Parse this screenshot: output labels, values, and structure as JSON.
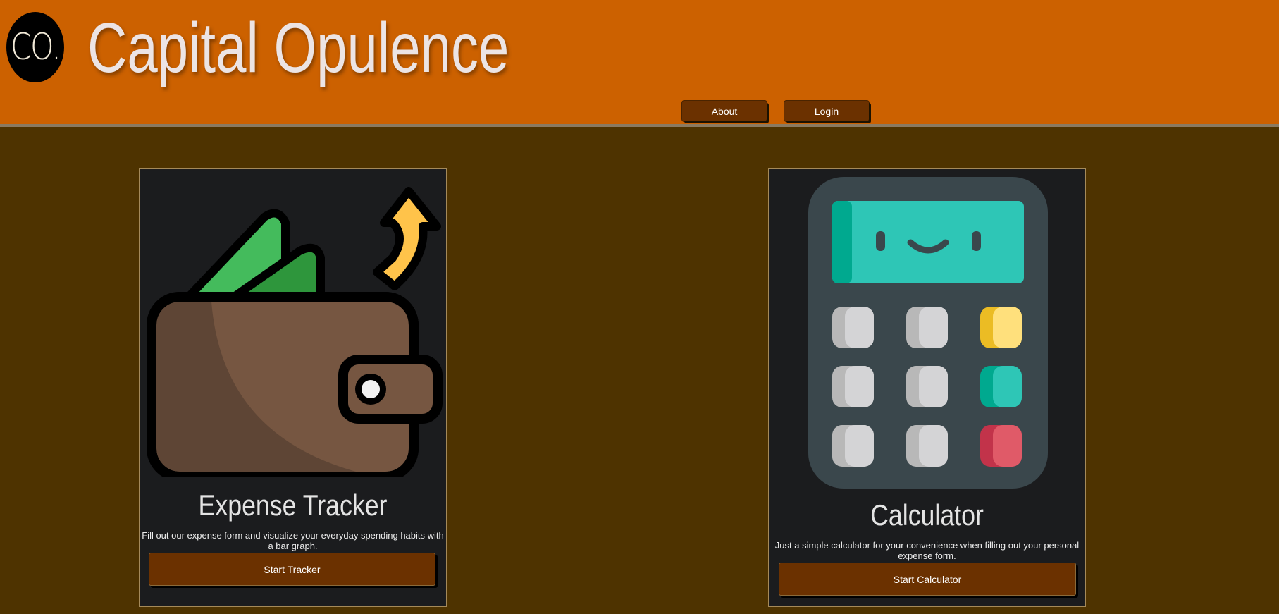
{
  "header": {
    "logo_text": "CO.",
    "brand": "Capital Opulence",
    "nav": [
      {
        "label": "About"
      },
      {
        "label": "Login"
      }
    ]
  },
  "cards": [
    {
      "icon": "wallet-icon",
      "title": "Expense Tracker",
      "description": "Fill out our expense form and visualize your everyday spending habits with a bar graph.",
      "button": "Start Tracker"
    },
    {
      "icon": "calculator-icon",
      "title": "Calculator",
      "description": "Just a simple calculator for your convenience when filling out your personal expense form.",
      "button": "Start Calculator"
    }
  ],
  "colors": {
    "header_bg": "#cc6100",
    "page_bg": "#4e3300",
    "card_bg": "#1b1c1e",
    "button_bg": "#6b3100"
  }
}
